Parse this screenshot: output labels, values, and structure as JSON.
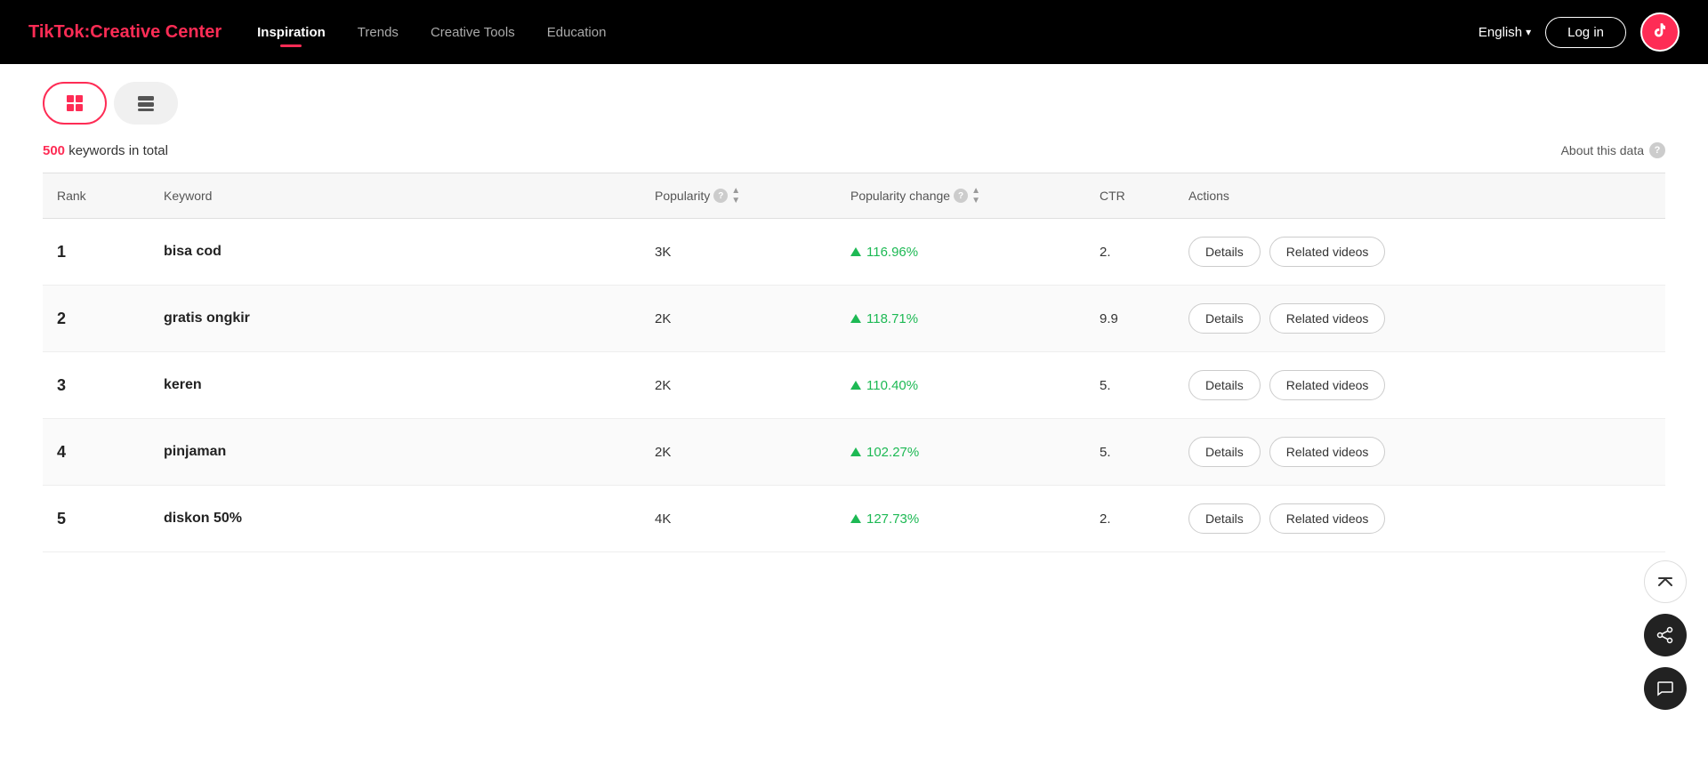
{
  "header": {
    "logo_tiktok": "TikTok",
    "logo_colon": ":",
    "logo_creative_center": "Creative Center",
    "nav": [
      {
        "id": "inspiration",
        "label": "Inspiration",
        "active": true
      },
      {
        "id": "trends",
        "label": "Trends",
        "active": false
      },
      {
        "id": "creative-tools",
        "label": "Creative Tools",
        "active": false
      },
      {
        "id": "education",
        "label": "Education",
        "active": false
      }
    ],
    "language": "English",
    "login_label": "Log in"
  },
  "toolbar": {
    "view_table_label": "⊞",
    "view_card_label": "⊟"
  },
  "keywords_section": {
    "count": "500",
    "count_suffix": " keywords in total",
    "about_label": "About this data"
  },
  "table": {
    "headers": [
      {
        "id": "rank",
        "label": "Rank",
        "has_info": false,
        "has_sort": false
      },
      {
        "id": "keyword",
        "label": "Keyword",
        "has_info": false,
        "has_sort": false
      },
      {
        "id": "popularity",
        "label": "Popularity",
        "has_info": true,
        "has_sort": true
      },
      {
        "id": "pop-change",
        "label": "Popularity change",
        "has_info": true,
        "has_sort": true
      },
      {
        "id": "ctr",
        "label": "CTR",
        "has_info": false,
        "has_sort": false
      },
      {
        "id": "actions",
        "label": "Actions",
        "has_info": false,
        "has_sort": false
      }
    ],
    "rows": [
      {
        "rank": "1",
        "keyword": "bisa cod",
        "popularity": "3K",
        "pop_change": "116.96%",
        "ctr": "2.",
        "details_label": "Details",
        "related_label": "Related videos"
      },
      {
        "rank": "2",
        "keyword": "gratis ongkir",
        "popularity": "2K",
        "pop_change": "118.71%",
        "ctr": "9.9",
        "details_label": "Details",
        "related_label": "Related videos"
      },
      {
        "rank": "3",
        "keyword": "keren",
        "popularity": "2K",
        "pop_change": "110.40%",
        "ctr": "5.",
        "details_label": "Details",
        "related_label": "Related videos"
      },
      {
        "rank": "4",
        "keyword": "pinjaman",
        "popularity": "2K",
        "pop_change": "102.27%",
        "ctr": "5.",
        "details_label": "Details",
        "related_label": "Related videos"
      },
      {
        "rank": "5",
        "keyword": "diskon 50%",
        "popularity": "4K",
        "pop_change": "127.73%",
        "ctr": "2.",
        "details_label": "Details",
        "related_label": "Related videos"
      }
    ]
  },
  "floating": {
    "share_icon": "↗",
    "chat_icon": "💬",
    "scroll_top_icon": "⇑"
  }
}
